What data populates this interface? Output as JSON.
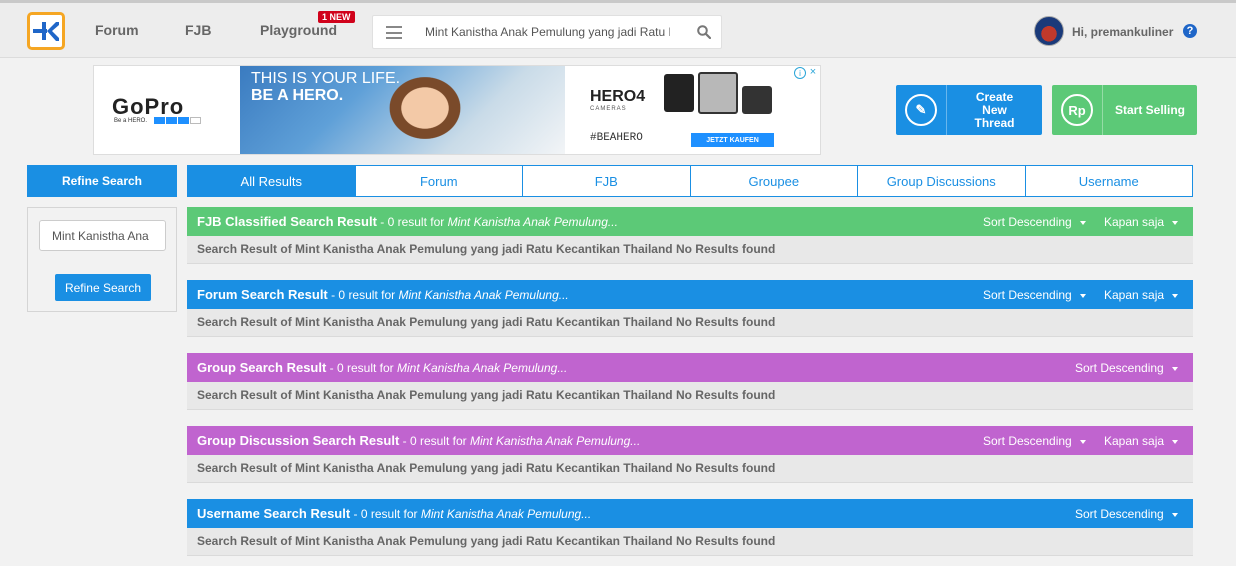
{
  "nav": {
    "forum": "Forum",
    "fjb": "FJB",
    "playground": "Playground",
    "new_badge": "1 NEW",
    "search_value": "Mint Kanistha Anak Pemulung yang jadi Ratu Kecantikan Thailand",
    "greeting": "Hi, premankuliner",
    "help": "?"
  },
  "ad": {
    "logo": "GoPro",
    "logo_sub": "Be a HERO.",
    "headline_1": "THIS IS YOUR LIFE.",
    "headline_2": "BE A HERO.",
    "product": "HERO4",
    "product_sub": "CAMERAS",
    "hashtag": "#BEAHERO",
    "buy": "JETZT KAUFEN",
    "info": "i",
    "close": "×"
  },
  "actions": {
    "create_icon": "✎",
    "create_label": "Create New Thread",
    "sell_icon": "Rp",
    "sell_label": "Start Selling"
  },
  "refine": {
    "title": "Refine Search",
    "input_value": "Mint Kanistha Ana",
    "button": "Refine Search"
  },
  "tabs": [
    {
      "label": "All Results"
    },
    {
      "label": "Forum"
    },
    {
      "label": "FJB"
    },
    {
      "label": "Groupee"
    },
    {
      "label": "Group Discussions"
    },
    {
      "label": "Username"
    }
  ],
  "results": [
    {
      "title": "FJB Classified Search Result",
      "count": " - 0 result for ",
      "query": "Mint Kanistha Anak Pemulung...",
      "sort": "Sort Descending",
      "time": "Kapan saja",
      "body": "Search Result of Mint Kanistha Anak Pemulung yang jadi Ratu Kecantikan Thailand No Results found",
      "color": "#5cc977"
    },
    {
      "title": "Forum Search Result",
      "count": " - 0 result for ",
      "query": "Mint Kanistha Anak Pemulung...",
      "sort": "Sort Descending",
      "time": "Kapan saja",
      "body": "Search Result of Mint Kanistha Anak Pemulung yang jadi Ratu Kecantikan Thailand No Results found",
      "color": "#1a8fe3"
    },
    {
      "title": "Group Search Result",
      "count": " - 0 result for ",
      "query": "Mint Kanistha Anak Pemulung...",
      "sort": "Sort Descending",
      "body": "Search Result of Mint Kanistha Anak Pemulung yang jadi Ratu Kecantikan Thailand No Results found",
      "color": "#c064cf"
    },
    {
      "title": "Group Discussion Search Result",
      "count": " - 0 result for ",
      "query": "Mint Kanistha Anak Pemulung...",
      "sort": "Sort Descending",
      "time": "Kapan saja",
      "body": "Search Result of Mint Kanistha Anak Pemulung yang jadi Ratu Kecantikan Thailand No Results found",
      "color": "#c064cf"
    },
    {
      "title": "Username Search Result",
      "count": " - 0 result for ",
      "query": "Mint Kanistha Anak Pemulung...",
      "sort": "Sort Descending",
      "body": "Search Result of Mint Kanistha Anak Pemulung yang jadi Ratu Kecantikan Thailand No Results found",
      "color": "#1a8fe3"
    }
  ]
}
